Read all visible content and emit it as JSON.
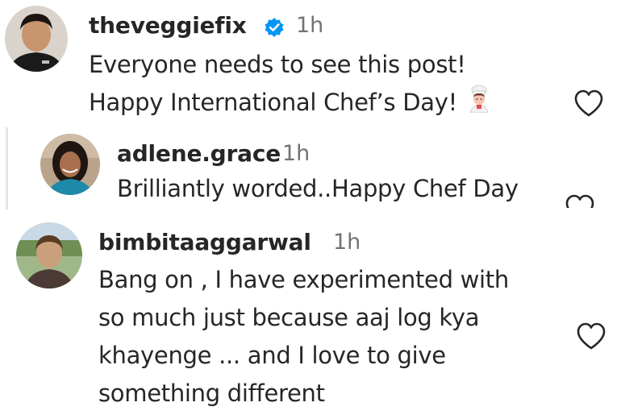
{
  "comments": [
    {
      "username": "theveggiefix",
      "verified": true,
      "time": "1h",
      "lines": [
        "Everyone needs to see this post!",
        "Happy International Chef’s Day!"
      ],
      "emoji": "chef-emoji",
      "liked": false
    },
    {
      "username": "adlene.grace",
      "time": "1h",
      "lines": [
        "Brilliantly worded..Happy Chef Day"
      ],
      "liked": false
    },
    {
      "username": "bimbitaaggarwal",
      "time": "1h",
      "lines": [
        "Bang on , I have experimented with",
        "so much just because aaj log kya",
        "khayenge ... and I love to give",
        "something different"
      ],
      "liked": false
    }
  ],
  "icons": {
    "like": "heart-outline-icon",
    "verified": "verified-badge-icon"
  },
  "colors": {
    "text": "#262626",
    "muted": "#737373",
    "verified": "#0095f6",
    "reply_line": "#e6e6e6"
  }
}
